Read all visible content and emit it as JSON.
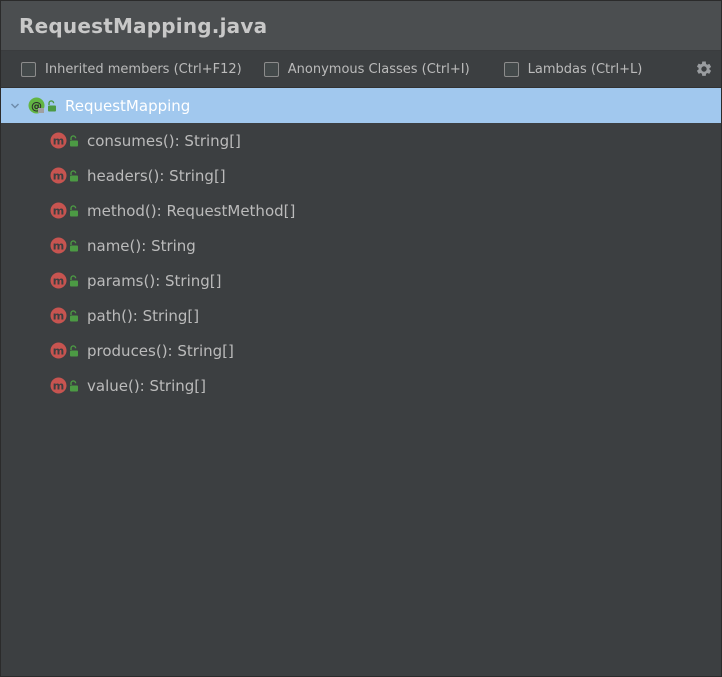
{
  "window": {
    "title": "RequestMapping.java"
  },
  "toolbar": {
    "inherited_label": "Inherited members (Ctrl+F12)",
    "anonymous_label": "Anonymous Classes (Ctrl+I)",
    "lambdas_label": "Lambdas (Ctrl+L)"
  },
  "tree": {
    "root_label": "RequestMapping",
    "members": [
      "consumes(): String[]",
      "headers(): String[]",
      "method(): RequestMethod[]",
      "name(): String",
      "params(): String[]",
      "path(): String[]",
      "produces(): String[]",
      "value(): String[]"
    ]
  },
  "colors": {
    "selection": "#a1c8ee",
    "background": "#3c3f41",
    "method_icon": "#c75450",
    "annotation_icon": "#62b543"
  },
  "icons": {
    "root": "annotation-icon",
    "member": "method-icon",
    "visibility": "public-lock-icon",
    "settings": "gear-icon",
    "expand": "chevron-down-icon"
  }
}
